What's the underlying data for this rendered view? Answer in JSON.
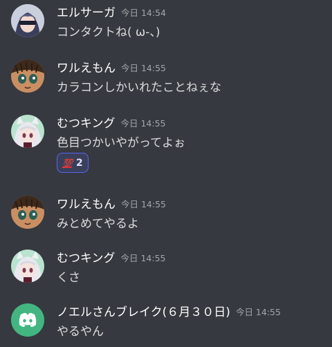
{
  "messages": [
    {
      "author": "エルサーガ",
      "time": "今日 14:54",
      "text": "コンタクトね( ω-、)"
    },
    {
      "author": "ワルえもん",
      "time": "今日 14:55",
      "text": "カラコンしかいれたことねぇな"
    },
    {
      "author": "むつキング",
      "time": "今日 14:55",
      "text": "色目つかいやがってよぉ",
      "reaction": {
        "emoji": "100-icon",
        "glyph": "💯",
        "count": "2"
      }
    },
    {
      "author": "ワルえもん",
      "time": "今日 14:55",
      "text": "みとめてやるよ"
    },
    {
      "author": "むつキング",
      "time": "今日 14:55",
      "text": "くさ"
    },
    {
      "author": "ノエルさんブレイク(６月３０日)",
      "time": "今日 14:55",
      "text": "やるやん"
    }
  ],
  "colors": {
    "background": "#36393f",
    "discord_blurple": "#5865f2",
    "discord_green": "#43b581"
  }
}
